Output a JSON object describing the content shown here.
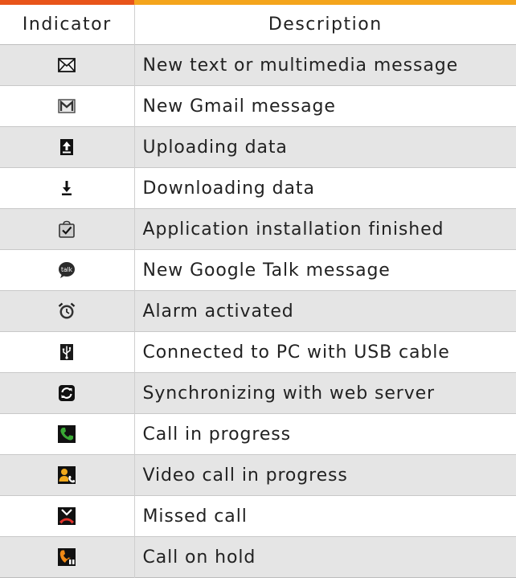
{
  "table": {
    "headers": {
      "indicator": "Indicator",
      "description": "Description"
    },
    "rows": [
      {
        "icon": "envelope-icon",
        "description": "New text or multimedia message"
      },
      {
        "icon": "gmail-icon",
        "description": "New Gmail message"
      },
      {
        "icon": "upload-icon",
        "description": "Uploading data"
      },
      {
        "icon": "download-icon",
        "description": "Downloading data"
      },
      {
        "icon": "install-finished-icon",
        "description": "Application installation finished"
      },
      {
        "icon": "talk-bubble-icon",
        "description": "New Google Talk message"
      },
      {
        "icon": "alarm-clock-icon",
        "description": "Alarm activated"
      },
      {
        "icon": "usb-icon",
        "description": "Connected to PC with USB cable"
      },
      {
        "icon": "sync-icon",
        "description": "Synchronizing with web server"
      },
      {
        "icon": "call-icon",
        "description": "Call in progress"
      },
      {
        "icon": "video-call-icon",
        "description": "Video call in progress"
      },
      {
        "icon": "missed-call-icon",
        "description": "Missed call"
      },
      {
        "icon": "call-hold-icon",
        "description": "Call on hold"
      }
    ],
    "talk_icon_text": "talk"
  },
  "colors": {
    "accent_left": "#e8541a",
    "accent_right": "#f4a51c",
    "row_shade": "#e5e5e5",
    "call_green": "#3aa935",
    "call_orange": "#f08a16",
    "missed_red": "#e0322b"
  }
}
